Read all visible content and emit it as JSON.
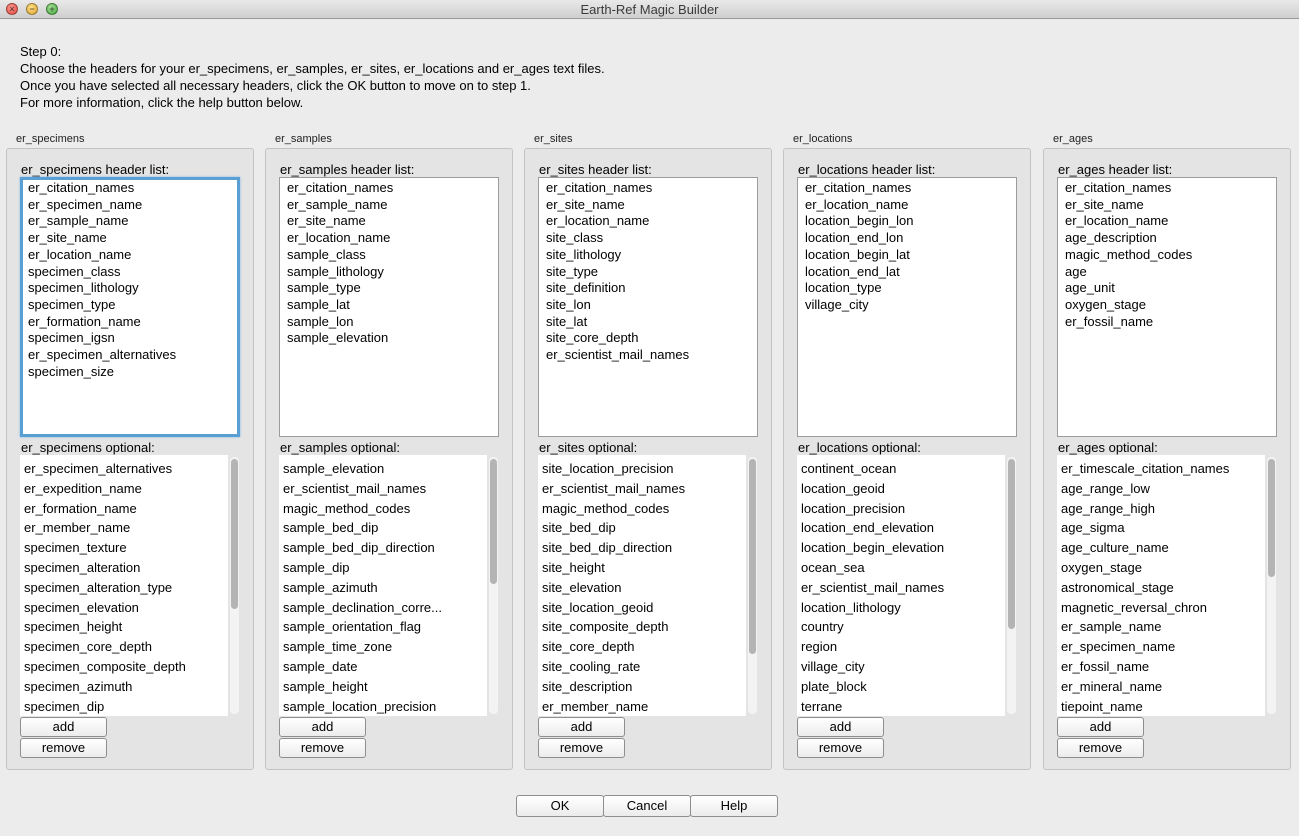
{
  "window": {
    "title": "Earth-Ref Magic Builder"
  },
  "instructions": [
    "Step 0:",
    "Choose the headers for your er_specimens, er_samples, er_sites, er_locations and er_ages text files.",
    "Once you have selected all necessary headers, click the OK button to move on to step 1.",
    "For more information, click the help button below."
  ],
  "panels": [
    {
      "group_label": "er_specimens",
      "header_list_label": "er_specimens header list:",
      "header_items": [
        "er_citation_names",
        "er_specimen_name",
        "er_sample_name",
        "er_site_name",
        "er_location_name",
        "specimen_class",
        "specimen_lithology",
        "specimen_type",
        "er_formation_name",
        "specimen_igsn",
        "er_specimen_alternatives",
        "specimen_size"
      ],
      "optional_label": "er_specimens optional:",
      "optional_items": [
        "er_specimen_alternatives",
        "er_expedition_name",
        "er_formation_name",
        "er_member_name",
        "specimen_texture",
        "specimen_alteration",
        "specimen_alteration_type",
        "specimen_elevation",
        "specimen_height",
        "specimen_core_depth",
        "specimen_composite_depth",
        "specimen_azimuth",
        "specimen_dip"
      ],
      "add_label": "add",
      "remove_label": "remove"
    },
    {
      "group_label": "er_samples",
      "header_list_label": "er_samples header list:",
      "header_items": [
        "er_citation_names",
        "er_sample_name",
        "er_site_name",
        "er_location_name",
        "sample_class",
        "sample_lithology",
        "sample_type",
        "sample_lat",
        "sample_lon",
        "sample_elevation"
      ],
      "optional_label": "er_samples optional:",
      "optional_items": [
        "sample_elevation",
        "er_scientist_mail_names",
        "magic_method_codes",
        "sample_bed_dip",
        "sample_bed_dip_direction",
        "sample_dip",
        "sample_azimuth",
        "sample_declination_corre...",
        "sample_orientation_flag",
        "sample_time_zone",
        "sample_date",
        "sample_height",
        "sample_location_precision"
      ],
      "add_label": "add",
      "remove_label": "remove"
    },
    {
      "group_label": "er_sites",
      "header_list_label": "er_sites header list:",
      "header_items": [
        "er_citation_names",
        "er_site_name",
        "er_location_name",
        "site_class",
        "site_lithology",
        "site_type",
        "site_definition",
        "site_lon",
        "site_lat",
        "site_core_depth",
        "er_scientist_mail_names"
      ],
      "optional_label": "er_sites optional:",
      "optional_items": [
        "site_location_precision",
        "er_scientist_mail_names",
        "magic_method_codes",
        "site_bed_dip",
        "site_bed_dip_direction",
        "site_height",
        "site_elevation",
        "site_location_geoid",
        "site_composite_depth",
        "site_core_depth",
        "site_cooling_rate",
        "site_description",
        "er_member_name"
      ],
      "add_label": "add",
      "remove_label": "remove"
    },
    {
      "group_label": "er_locations",
      "header_list_label": "er_locations header list:",
      "header_items": [
        "er_citation_names",
        "er_location_name",
        "location_begin_lon",
        "location_end_lon",
        "location_begin_lat",
        "location_end_lat",
        "location_type",
        "village_city"
      ],
      "optional_label": "er_locations optional:",
      "optional_items": [
        "continent_ocean",
        "location_geoid",
        "location_precision",
        "location_end_elevation",
        "location_begin_elevation",
        "ocean_sea",
        "er_scientist_mail_names",
        "location_lithology",
        "country",
        "region",
        "village_city",
        "plate_block",
        "terrane"
      ],
      "add_label": "add",
      "remove_label": "remove"
    },
    {
      "group_label": "er_ages",
      "header_list_label": "er_ages header list:",
      "header_items": [
        "er_citation_names",
        "er_site_name",
        "er_location_name",
        "age_description",
        "magic_method_codes",
        "age",
        "age_unit",
        "oxygen_stage",
        "er_fossil_name"
      ],
      "optional_label": "er_ages optional:",
      "optional_items": [
        "er_timescale_citation_names",
        "age_range_low",
        "age_range_high",
        "age_sigma",
        "age_culture_name",
        "oxygen_stage",
        "astronomical_stage",
        "magnetic_reversal_chron",
        "er_sample_name",
        "er_specimen_name",
        "er_fossil_name",
        "er_mineral_name",
        "tiepoint_name"
      ],
      "add_label": "add",
      "remove_label": "remove"
    }
  ],
  "buttons": {
    "ok": "OK",
    "cancel": "Cancel",
    "help": "Help"
  },
  "colors": {
    "focus_ring": "#5a9fd4",
    "window_bg": "#ececec"
  }
}
